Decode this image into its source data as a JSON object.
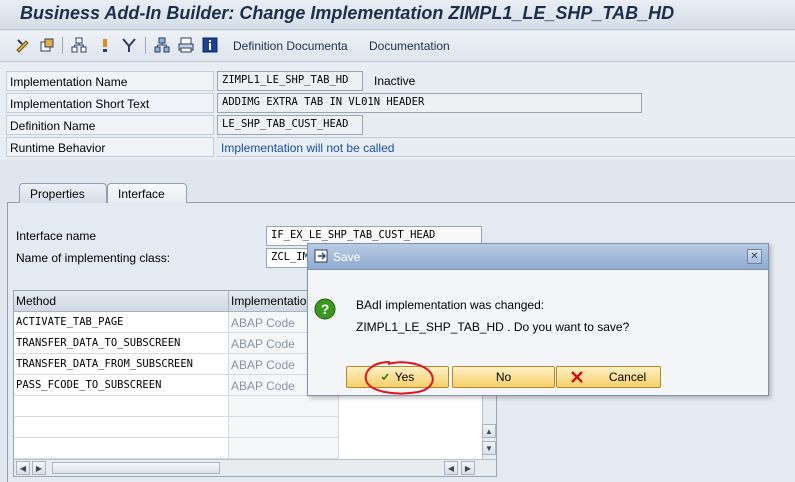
{
  "window": {
    "title": "Business Add-In Builder: Change Implementation ZIMPL1_LE_SHP_TAB_HD"
  },
  "toolbar": {
    "definition_doc": "Definition Documenta",
    "documentation": "Documentation"
  },
  "header": {
    "impl_name_label": "Implementation Name",
    "impl_name_value": "ZIMPL1_LE_SHP_TAB_HD",
    "impl_status": "Inactive",
    "short_text_label": "Implementation Short Text",
    "short_text_value": "ADDIMG EXTRA TAB IN VL01N HEADER",
    "def_name_label": "Definition Name",
    "def_name_value": "LE_SHP_TAB_CUST_HEAD",
    "runtime_label": "Runtime Behavior",
    "runtime_value": "Implementation will not be called"
  },
  "tabs": {
    "properties": "Properties",
    "interface": "Interface"
  },
  "interface": {
    "name_label": "Interface name",
    "name_value": "IF_EX_LE_SHP_TAB_CUST_HEAD",
    "class_label": "Name of implementing class:",
    "class_value": "ZCL_IM"
  },
  "table": {
    "headers": [
      "Method",
      "Implementatio"
    ],
    "rows": [
      {
        "method": "ACTIVATE_TAB_PAGE",
        "impl": "ABAP Code"
      },
      {
        "method": "TRANSFER_DATA_TO_SUBSCREEN",
        "impl": "ABAP Code"
      },
      {
        "method": "TRANSFER_DATA_FROM_SUBSCREEN",
        "impl": "ABAP Code"
      },
      {
        "method": "PASS_FCODE_TO_SUBSCREEN",
        "impl": "ABAP Code"
      }
    ]
  },
  "dialog": {
    "title": "Save",
    "line1": "BAdI implementation was changed:",
    "line2": "ZIMPL1_LE_SHP_TAB_HD . Do you want to save?",
    "yes": "Yes",
    "no": "No",
    "cancel": "Cancel"
  },
  "colors": {
    "accent": "#1c2f4a",
    "button": "#f5cf6a",
    "annotation": "#e0141e",
    "question": "#3a9a1e"
  }
}
